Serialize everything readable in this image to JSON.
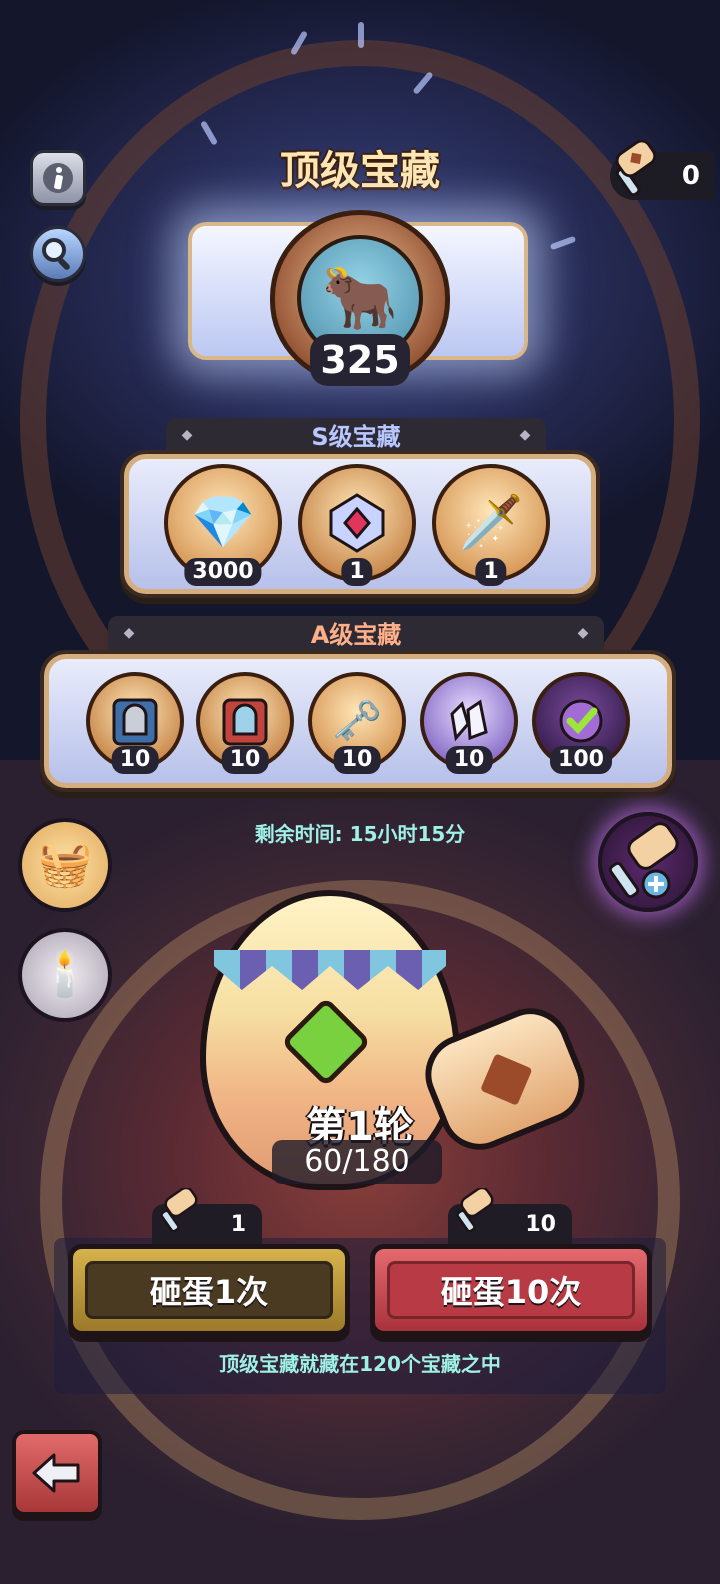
{
  "header": {
    "title": "顶级宝藏",
    "hammer_count": "0",
    "info_icon": "info-icon",
    "search_icon": "magnifier-icon"
  },
  "top_prize": {
    "icon": "bull-warrior-portrait",
    "count": "325"
  },
  "s_tier": {
    "label": "S级宝藏",
    "items": [
      {
        "icon": "pink-diamond-icon",
        "qty": "3000"
      },
      {
        "icon": "crystal-badge-icon",
        "qty": "1"
      },
      {
        "icon": "ssr-sword-dice-icon",
        "qty": "1"
      }
    ]
  },
  "a_tier": {
    "label": "A级宝藏",
    "items": [
      {
        "icon": "blue-helmet-book-icon",
        "qty": "10"
      },
      {
        "icon": "red-helmet-book-icon",
        "qty": "10"
      },
      {
        "icon": "key-scroll-icon",
        "qty": "10"
      },
      {
        "icon": "crystal-shards-icon",
        "qty": "10"
      },
      {
        "icon": "purple-check-orb-icon",
        "qty": "100"
      }
    ]
  },
  "timer": "剩余时间: 15小时15分",
  "side": {
    "left_top_icon": "gift-basket-icon",
    "left_bottom_icon": "candle-icon",
    "right_icon": "hammer-plus-icon"
  },
  "round": {
    "title": "第1轮",
    "progress": "60/180"
  },
  "actions": {
    "smash_one_cost": "1",
    "smash_one_label": "砸蛋1次",
    "smash_ten_cost": "10",
    "smash_ten_label": "砸蛋10次"
  },
  "hint": "顶级宝藏就藏在120个宝藏之中",
  "back_icon": "back-arrow-icon",
  "colors": {
    "gold_button": "#b8953a",
    "red_button": "#c8444c",
    "teal_text": "#9ff0e6"
  }
}
